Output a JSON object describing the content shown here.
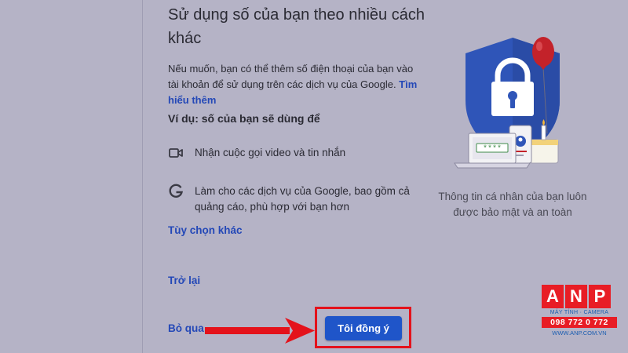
{
  "title": "Sử dụng số của bạn theo nhiều cách khác",
  "intro": {
    "text": "Nếu muốn, bạn có thể thêm số điện thoại của bạn vào tài khoản để sử dụng trên các dịch vụ của Google. ",
    "link": "Tìm hiểu thêm"
  },
  "example_heading": "Ví dụ: số của bạn sẽ dùng để",
  "features": [
    {
      "icon": "video-camera-icon",
      "text": "Nhận cuộc gọi video và tin nhắn"
    },
    {
      "icon": "google-g-icon",
      "text": "Làm cho các dịch vụ của Google, bao gồm cả quảng cáo, phù hợp với bạn hơn"
    }
  ],
  "more_options": "Tùy chọn khác",
  "back": "Trở lại",
  "skip": "Bỏ qua",
  "agree": "Tôi đồng ý",
  "caption": "Thông tin cá nhân của bạn luôn được bảo mật và an toàn",
  "laptop_password": "****",
  "watermark": {
    "letters": [
      "A",
      "N",
      "P"
    ],
    "tagline": "MÁY TÍNH · CAMERA",
    "phone": "098 772 0 772",
    "website": "WWW.ANP.COM.VN"
  },
  "colors": {
    "background": "#b5b3c6",
    "link": "#2448b7",
    "primary_button": "#1f55c9",
    "highlight": "#e4121b",
    "shield": "#2f55b8",
    "balloon": "#c3222a"
  }
}
